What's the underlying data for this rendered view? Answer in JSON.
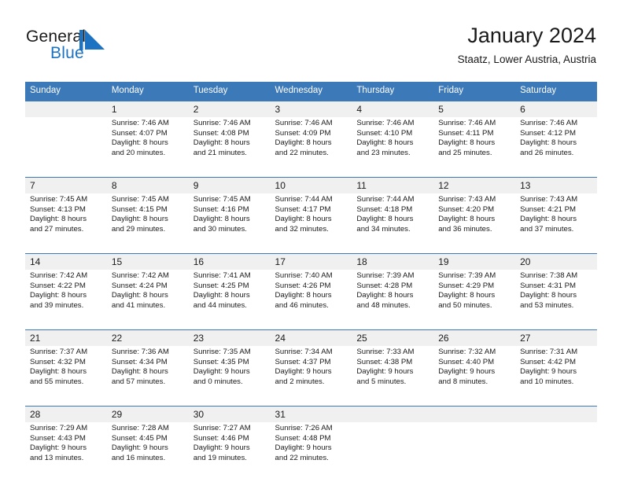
{
  "brand": {
    "name_part1": "General",
    "name_part2": "Blue",
    "logo_color": "#1d72c2"
  },
  "header": {
    "month_title": "January 2024",
    "location": "Staatz, Lower Austria, Austria",
    "header_bg_color": "#3c79b8",
    "daynum_bg_color": "#f0f0f0"
  },
  "calendar": {
    "weekday_headers": [
      "Sunday",
      "Monday",
      "Tuesday",
      "Wednesday",
      "Thursday",
      "Friday",
      "Saturday"
    ],
    "weeks": [
      [
        {
          "day": "",
          "sunrise": "",
          "sunset": "",
          "daylight_line1": "",
          "daylight_line2": "",
          "empty": true
        },
        {
          "day": "1",
          "sunrise": "Sunrise: 7:46 AM",
          "sunset": "Sunset: 4:07 PM",
          "daylight_line1": "Daylight: 8 hours",
          "daylight_line2": "and 20 minutes.",
          "empty": false
        },
        {
          "day": "2",
          "sunrise": "Sunrise: 7:46 AM",
          "sunset": "Sunset: 4:08 PM",
          "daylight_line1": "Daylight: 8 hours",
          "daylight_line2": "and 21 minutes.",
          "empty": false
        },
        {
          "day": "3",
          "sunrise": "Sunrise: 7:46 AM",
          "sunset": "Sunset: 4:09 PM",
          "daylight_line1": "Daylight: 8 hours",
          "daylight_line2": "and 22 minutes.",
          "empty": false
        },
        {
          "day": "4",
          "sunrise": "Sunrise: 7:46 AM",
          "sunset": "Sunset: 4:10 PM",
          "daylight_line1": "Daylight: 8 hours",
          "daylight_line2": "and 23 minutes.",
          "empty": false
        },
        {
          "day": "5",
          "sunrise": "Sunrise: 7:46 AM",
          "sunset": "Sunset: 4:11 PM",
          "daylight_line1": "Daylight: 8 hours",
          "daylight_line2": "and 25 minutes.",
          "empty": false
        },
        {
          "day": "6",
          "sunrise": "Sunrise: 7:46 AM",
          "sunset": "Sunset: 4:12 PM",
          "daylight_line1": "Daylight: 8 hours",
          "daylight_line2": "and 26 minutes.",
          "empty": false
        }
      ],
      [
        {
          "day": "7",
          "sunrise": "Sunrise: 7:45 AM",
          "sunset": "Sunset: 4:13 PM",
          "daylight_line1": "Daylight: 8 hours",
          "daylight_line2": "and 27 minutes.",
          "empty": false
        },
        {
          "day": "8",
          "sunrise": "Sunrise: 7:45 AM",
          "sunset": "Sunset: 4:15 PM",
          "daylight_line1": "Daylight: 8 hours",
          "daylight_line2": "and 29 minutes.",
          "empty": false
        },
        {
          "day": "9",
          "sunrise": "Sunrise: 7:45 AM",
          "sunset": "Sunset: 4:16 PM",
          "daylight_line1": "Daylight: 8 hours",
          "daylight_line2": "and 30 minutes.",
          "empty": false
        },
        {
          "day": "10",
          "sunrise": "Sunrise: 7:44 AM",
          "sunset": "Sunset: 4:17 PM",
          "daylight_line1": "Daylight: 8 hours",
          "daylight_line2": "and 32 minutes.",
          "empty": false
        },
        {
          "day": "11",
          "sunrise": "Sunrise: 7:44 AM",
          "sunset": "Sunset: 4:18 PM",
          "daylight_line1": "Daylight: 8 hours",
          "daylight_line2": "and 34 minutes.",
          "empty": false
        },
        {
          "day": "12",
          "sunrise": "Sunrise: 7:43 AM",
          "sunset": "Sunset: 4:20 PM",
          "daylight_line1": "Daylight: 8 hours",
          "daylight_line2": "and 36 minutes.",
          "empty": false
        },
        {
          "day": "13",
          "sunrise": "Sunrise: 7:43 AM",
          "sunset": "Sunset: 4:21 PM",
          "daylight_line1": "Daylight: 8 hours",
          "daylight_line2": "and 37 minutes.",
          "empty": false
        }
      ],
      [
        {
          "day": "14",
          "sunrise": "Sunrise: 7:42 AM",
          "sunset": "Sunset: 4:22 PM",
          "daylight_line1": "Daylight: 8 hours",
          "daylight_line2": "and 39 minutes.",
          "empty": false
        },
        {
          "day": "15",
          "sunrise": "Sunrise: 7:42 AM",
          "sunset": "Sunset: 4:24 PM",
          "daylight_line1": "Daylight: 8 hours",
          "daylight_line2": "and 41 minutes.",
          "empty": false
        },
        {
          "day": "16",
          "sunrise": "Sunrise: 7:41 AM",
          "sunset": "Sunset: 4:25 PM",
          "daylight_line1": "Daylight: 8 hours",
          "daylight_line2": "and 44 minutes.",
          "empty": false
        },
        {
          "day": "17",
          "sunrise": "Sunrise: 7:40 AM",
          "sunset": "Sunset: 4:26 PM",
          "daylight_line1": "Daylight: 8 hours",
          "daylight_line2": "and 46 minutes.",
          "empty": false
        },
        {
          "day": "18",
          "sunrise": "Sunrise: 7:39 AM",
          "sunset": "Sunset: 4:28 PM",
          "daylight_line1": "Daylight: 8 hours",
          "daylight_line2": "and 48 minutes.",
          "empty": false
        },
        {
          "day": "19",
          "sunrise": "Sunrise: 7:39 AM",
          "sunset": "Sunset: 4:29 PM",
          "daylight_line1": "Daylight: 8 hours",
          "daylight_line2": "and 50 minutes.",
          "empty": false
        },
        {
          "day": "20",
          "sunrise": "Sunrise: 7:38 AM",
          "sunset": "Sunset: 4:31 PM",
          "daylight_line1": "Daylight: 8 hours",
          "daylight_line2": "and 53 minutes.",
          "empty": false
        }
      ],
      [
        {
          "day": "21",
          "sunrise": "Sunrise: 7:37 AM",
          "sunset": "Sunset: 4:32 PM",
          "daylight_line1": "Daylight: 8 hours",
          "daylight_line2": "and 55 minutes.",
          "empty": false
        },
        {
          "day": "22",
          "sunrise": "Sunrise: 7:36 AM",
          "sunset": "Sunset: 4:34 PM",
          "daylight_line1": "Daylight: 8 hours",
          "daylight_line2": "and 57 minutes.",
          "empty": false
        },
        {
          "day": "23",
          "sunrise": "Sunrise: 7:35 AM",
          "sunset": "Sunset: 4:35 PM",
          "daylight_line1": "Daylight: 9 hours",
          "daylight_line2": "and 0 minutes.",
          "empty": false
        },
        {
          "day": "24",
          "sunrise": "Sunrise: 7:34 AM",
          "sunset": "Sunset: 4:37 PM",
          "daylight_line1": "Daylight: 9 hours",
          "daylight_line2": "and 2 minutes.",
          "empty": false
        },
        {
          "day": "25",
          "sunrise": "Sunrise: 7:33 AM",
          "sunset": "Sunset: 4:38 PM",
          "daylight_line1": "Daylight: 9 hours",
          "daylight_line2": "and 5 minutes.",
          "empty": false
        },
        {
          "day": "26",
          "sunrise": "Sunrise: 7:32 AM",
          "sunset": "Sunset: 4:40 PM",
          "daylight_line1": "Daylight: 9 hours",
          "daylight_line2": "and 8 minutes.",
          "empty": false
        },
        {
          "day": "27",
          "sunrise": "Sunrise: 7:31 AM",
          "sunset": "Sunset: 4:42 PM",
          "daylight_line1": "Daylight: 9 hours",
          "daylight_line2": "and 10 minutes.",
          "empty": false
        }
      ],
      [
        {
          "day": "28",
          "sunrise": "Sunrise: 7:29 AM",
          "sunset": "Sunset: 4:43 PM",
          "daylight_line1": "Daylight: 9 hours",
          "daylight_line2": "and 13 minutes.",
          "empty": false
        },
        {
          "day": "29",
          "sunrise": "Sunrise: 7:28 AM",
          "sunset": "Sunset: 4:45 PM",
          "daylight_line1": "Daylight: 9 hours",
          "daylight_line2": "and 16 minutes.",
          "empty": false
        },
        {
          "day": "30",
          "sunrise": "Sunrise: 7:27 AM",
          "sunset": "Sunset: 4:46 PM",
          "daylight_line1": "Daylight: 9 hours",
          "daylight_line2": "and 19 minutes.",
          "empty": false
        },
        {
          "day": "31",
          "sunrise": "Sunrise: 7:26 AM",
          "sunset": "Sunset: 4:48 PM",
          "daylight_line1": "Daylight: 9 hours",
          "daylight_line2": "and 22 minutes.",
          "empty": false
        },
        {
          "day": "",
          "sunrise": "",
          "sunset": "",
          "daylight_line1": "",
          "daylight_line2": "",
          "empty": true
        },
        {
          "day": "",
          "sunrise": "",
          "sunset": "",
          "daylight_line1": "",
          "daylight_line2": "",
          "empty": true
        },
        {
          "day": "",
          "sunrise": "",
          "sunset": "",
          "daylight_line1": "",
          "daylight_line2": "",
          "empty": true
        }
      ]
    ]
  }
}
